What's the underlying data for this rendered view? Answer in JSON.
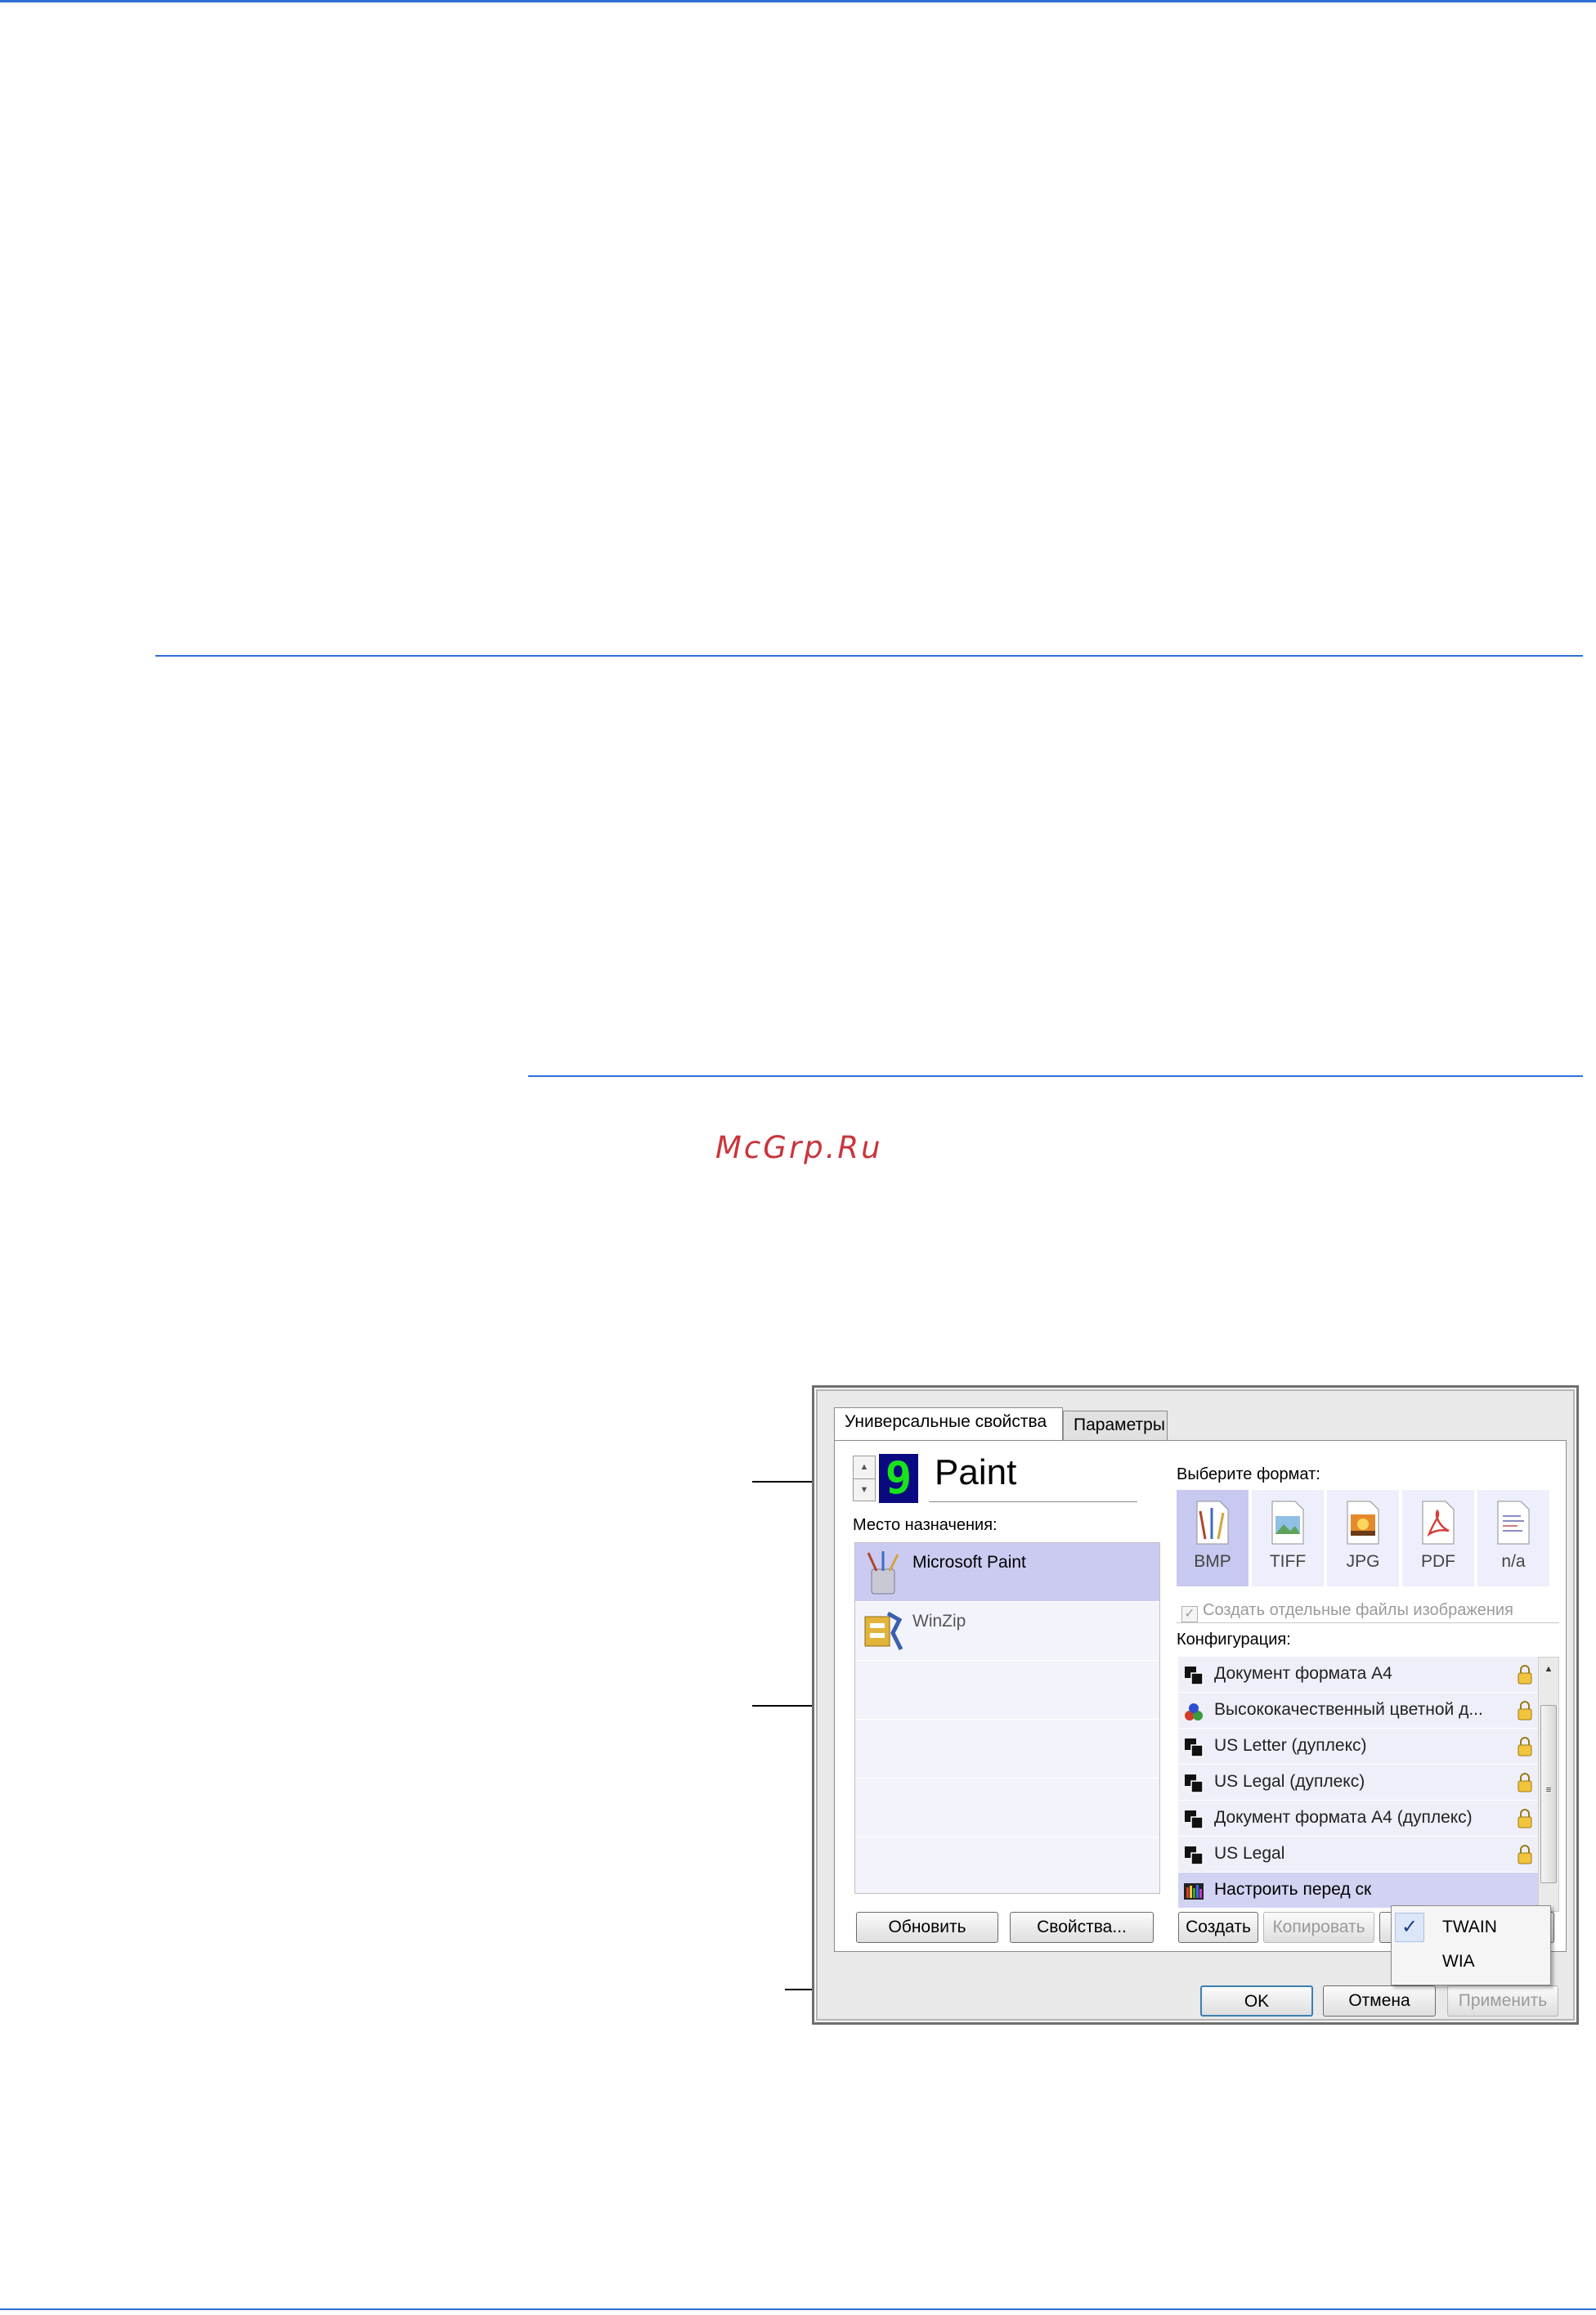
{
  "watermark": "McGrp.Ru",
  "dialog": {
    "tabs": [
      {
        "label": "Универсальные свойства",
        "active": true
      },
      {
        "label": "Параметры",
        "active": false
      }
    ],
    "counter_digit": "9",
    "app_name": "Paint",
    "destination_label": "Место назначения:",
    "destinations": [
      {
        "name": "Microsoft Paint",
        "icon": "paint-brushes-icon",
        "selected": true
      },
      {
        "name": "WinZip",
        "icon": "winzip-icon",
        "selected": false
      }
    ],
    "format_label": "Выберите формат:",
    "formats": [
      {
        "label": "BMP",
        "icon": "bmp-icon",
        "selected": true
      },
      {
        "label": "TIFF",
        "icon": "tiff-icon",
        "selected": false
      },
      {
        "label": "JPG",
        "icon": "jpg-icon",
        "selected": false
      },
      {
        "label": "PDF",
        "icon": "pdf-icon",
        "selected": false
      },
      {
        "label": "n/a",
        "icon": "na-icon",
        "selected": false
      }
    ],
    "separate_files_label": "Создать отдельные файлы изображения",
    "config_label": "Конфигурация:",
    "configurations": [
      {
        "name": "Документ формата А4",
        "icon": "bw-document-icon",
        "locked": true
      },
      {
        "name": "Высококачественный цветной д...",
        "icon": "color-document-icon",
        "locked": true
      },
      {
        "name": "US Letter (дуплекс)",
        "icon": "bw-document-icon",
        "locked": true
      },
      {
        "name": "US Legal (дуплекс)",
        "icon": "bw-document-icon",
        "locked": true
      },
      {
        "name": "Документ формата А4 (дуплекс)",
        "icon": "bw-document-icon",
        "locked": true
      },
      {
        "name": "US Legal",
        "icon": "bw-document-icon",
        "locked": true
      },
      {
        "name": "Настроить перед ск",
        "icon": "configure-icon",
        "locked": false
      }
    ],
    "left_buttons": {
      "refresh": "Обновить",
      "properties": "Свойства..."
    },
    "right_buttons": {
      "create": "Создать",
      "copy": "Копировать"
    },
    "context_menu": [
      {
        "label": "TWAIN",
        "checked": true
      },
      {
        "label": "WIA",
        "checked": false
      }
    ],
    "footer_buttons": {
      "ok": "OK",
      "cancel": "Отмена",
      "apply": "Применить"
    }
  }
}
